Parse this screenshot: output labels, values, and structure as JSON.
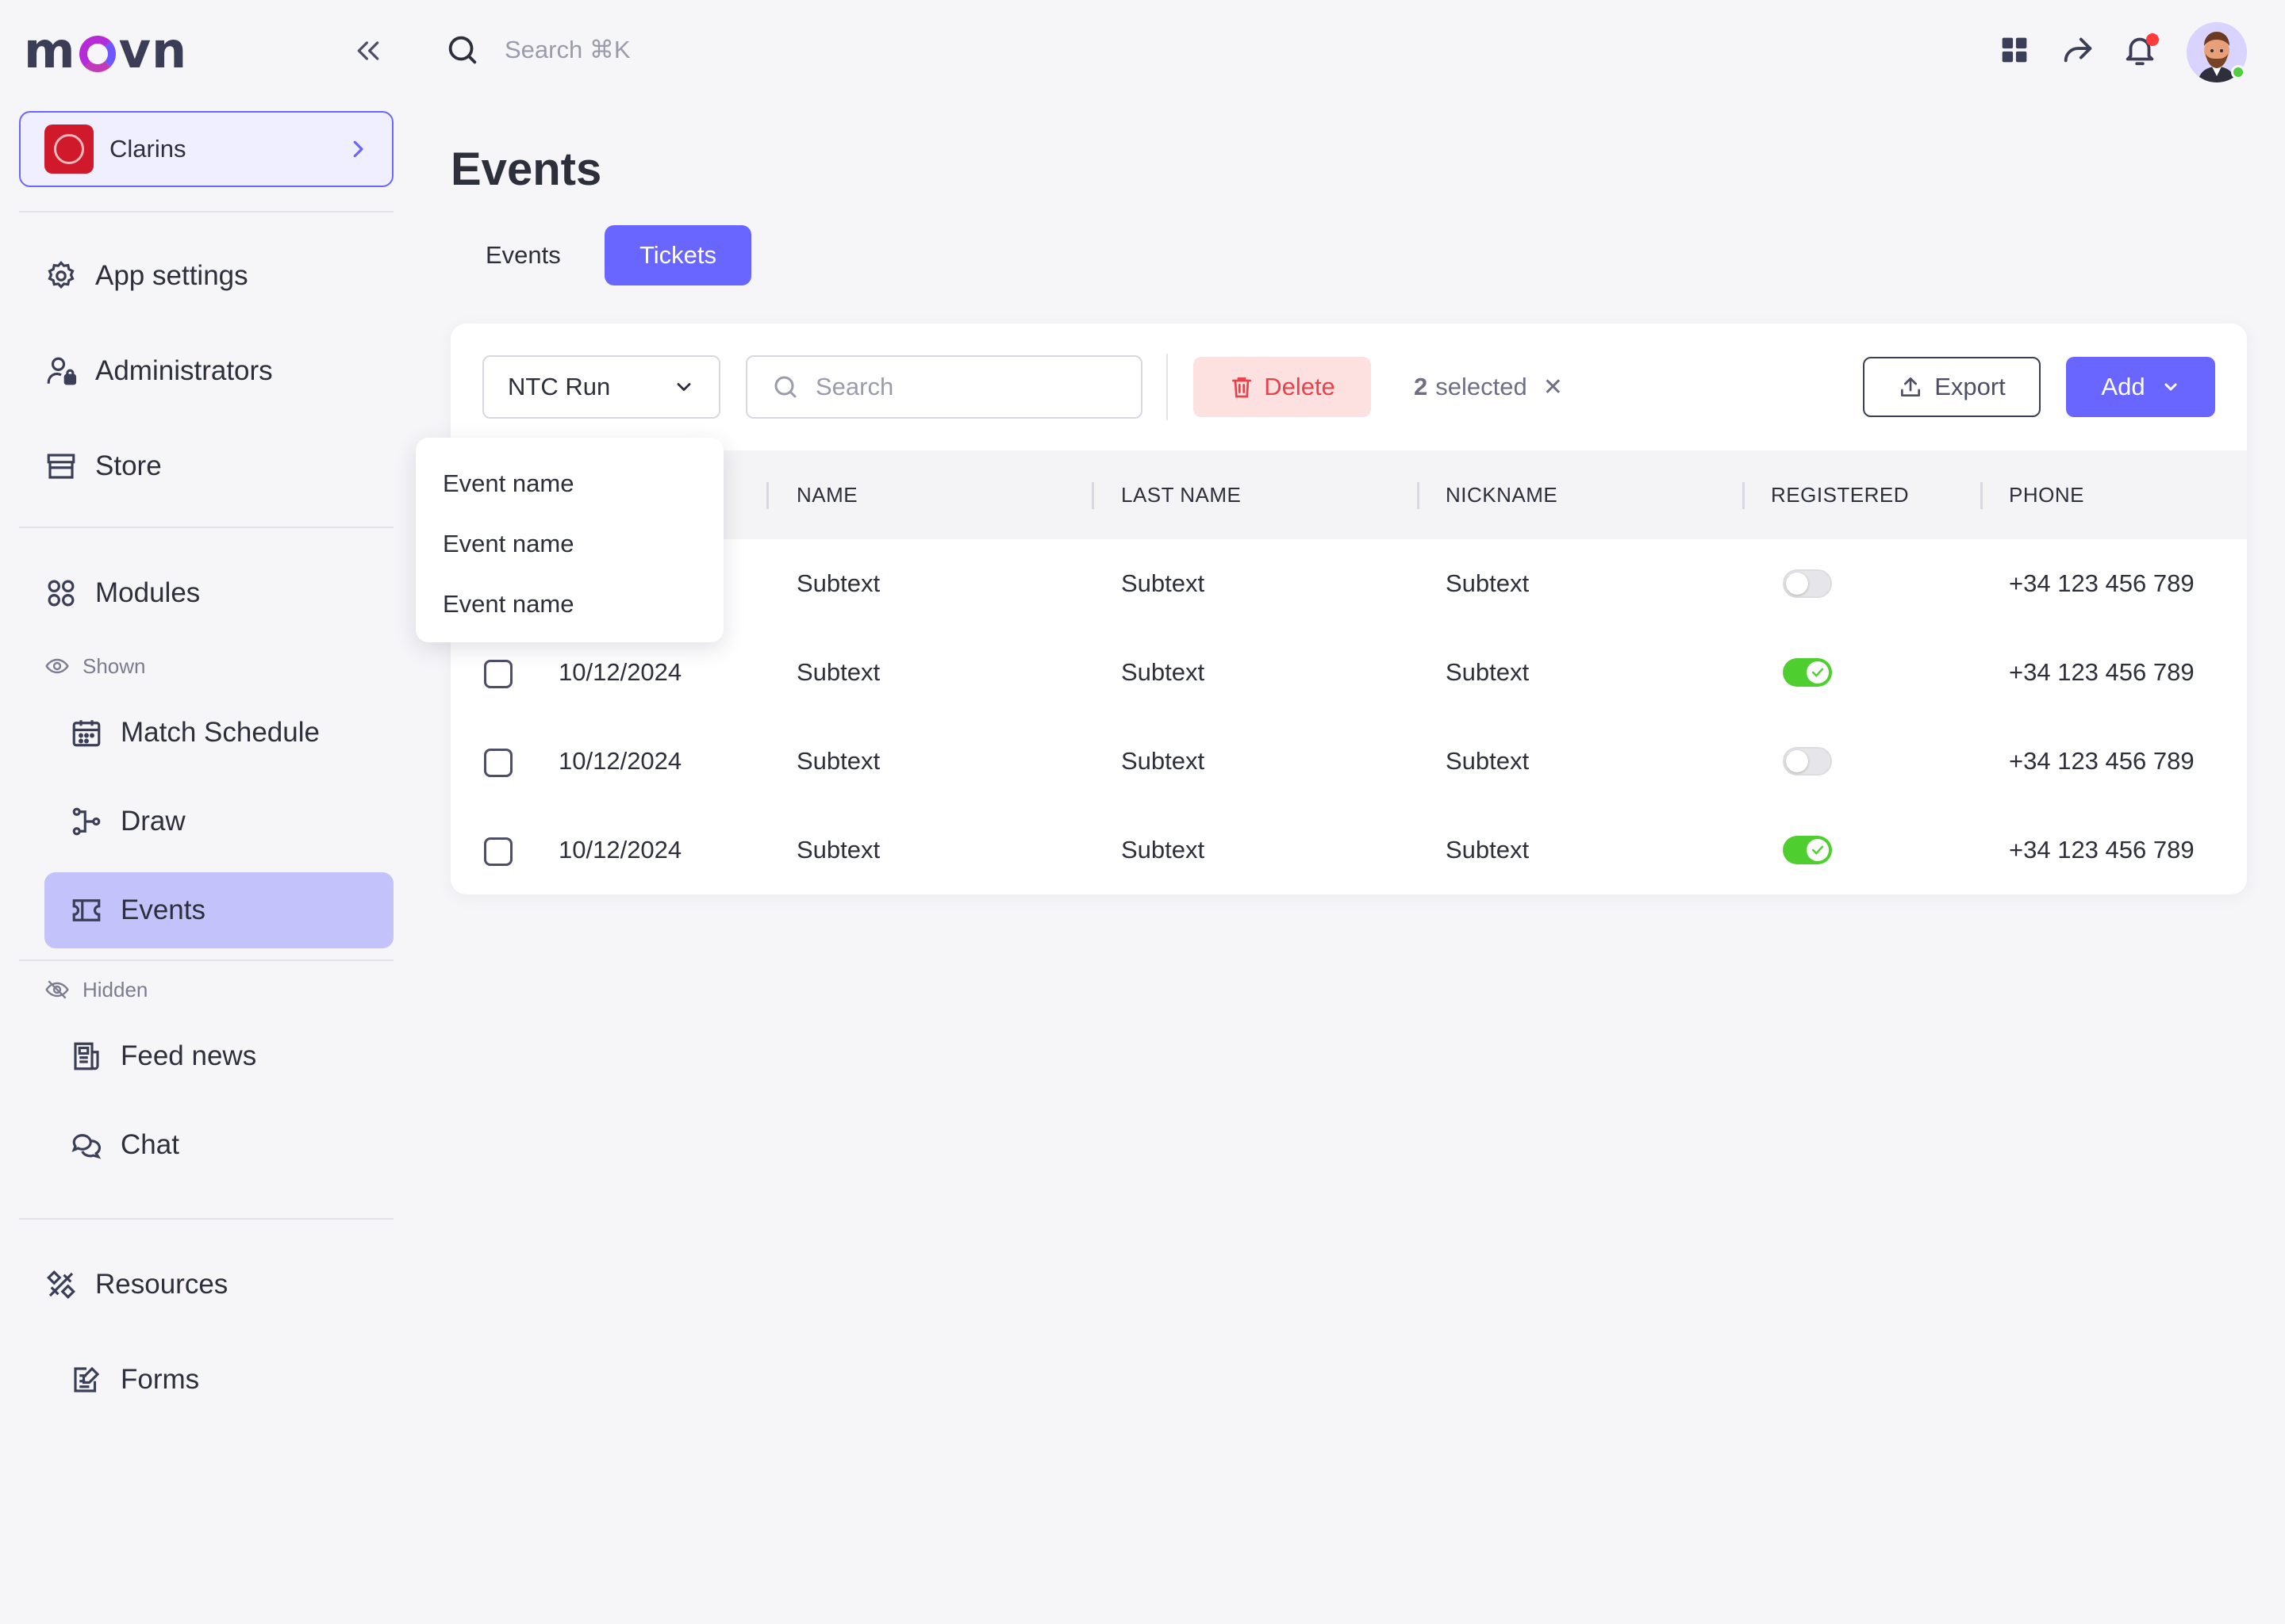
{
  "brand": {
    "logo_text_1": "m",
    "logo_text_2": "vn",
    "colors": {
      "accent": "#6966ff",
      "logo_gradient": "#b52bd8",
      "danger": "#e8434a",
      "success": "#4fcf2f"
    }
  },
  "sidebar": {
    "org": {
      "name": "Clarins",
      "icon": "chevron-right-icon"
    },
    "items": [
      {
        "label": "App settings",
        "icon": "gear-icon"
      },
      {
        "label": "Administrators",
        "icon": "user-lock-icon"
      },
      {
        "label": "Store",
        "icon": "store-icon"
      },
      {
        "label": "Modules",
        "icon": "modules-icon"
      }
    ],
    "shown_label": "Shown",
    "shown_items": [
      {
        "label": "Match Schedule",
        "icon": "calendar-icon"
      },
      {
        "label": "Draw",
        "icon": "bracket-icon"
      },
      {
        "label": "Events",
        "icon": "ticket-icon",
        "active": true
      }
    ],
    "hidden_label": "Hidden",
    "hidden_items": [
      {
        "label": "Feed news",
        "icon": "newspaper-icon"
      },
      {
        "label": "Chat",
        "icon": "chat-icon"
      }
    ],
    "bottom_items": [
      {
        "label": "Resources",
        "icon": "tools-icon"
      },
      {
        "label": "Forms",
        "icon": "form-icon"
      }
    ]
  },
  "topbar": {
    "search_placeholder": "Search ⌘K",
    "icons": [
      "grid-icon",
      "share-icon",
      "bell-icon",
      "avatar"
    ]
  },
  "page": {
    "title": "Events",
    "tabs": [
      {
        "label": "Events",
        "active": false
      },
      {
        "label": "Tickets",
        "active": true
      }
    ]
  },
  "toolbar": {
    "event_select": "NTC Run",
    "search_placeholder": "Search",
    "delete_label": "Delete",
    "selected_count": "2",
    "selected_text": "selected",
    "export_label": "Export",
    "add_label": "Add"
  },
  "dropdown": {
    "options": [
      "Event name",
      "Event name",
      "Event name"
    ]
  },
  "table": {
    "columns": [
      "NAME",
      "LAST NAME",
      "NICKNAME",
      "REGISTERED",
      "PHONE"
    ],
    "rows": [
      {
        "date": "",
        "name": "Subtext",
        "last_name": "Subtext",
        "nickname": "Subtext",
        "registered": false,
        "phone": "+34 123 456 789"
      },
      {
        "date": "10/12/2024",
        "name": "Subtext",
        "last_name": "Subtext",
        "nickname": "Subtext",
        "registered": true,
        "phone": "+34 123 456 789"
      },
      {
        "date": "10/12/2024",
        "name": "Subtext",
        "last_name": "Subtext",
        "nickname": "Subtext",
        "registered": false,
        "phone": "+34 123 456 789"
      },
      {
        "date": "10/12/2024",
        "name": "Subtext",
        "last_name": "Subtext",
        "nickname": "Subtext",
        "registered": true,
        "phone": "+34 123 456 789"
      }
    ]
  }
}
